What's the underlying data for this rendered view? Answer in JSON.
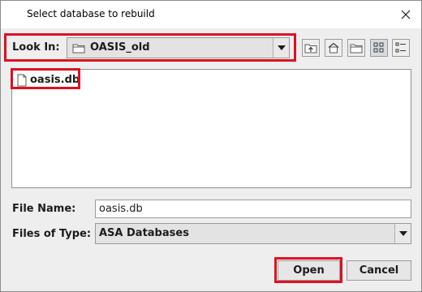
{
  "dialog": {
    "title": "Select database to rebuild",
    "close_glyph": "✕"
  },
  "look_in": {
    "label": "Look In:",
    "value": "OASIS_old",
    "icon": "folder-icon"
  },
  "toolbar": {
    "buttons": [
      {
        "name": "up-one-level-button",
        "icon": "folder-up-icon"
      },
      {
        "name": "home-button",
        "icon": "home-icon"
      },
      {
        "name": "new-folder-button",
        "icon": "new-folder-icon"
      },
      {
        "name": "list-view-button",
        "icon": "list-view-icon",
        "active": true
      },
      {
        "name": "details-view-button",
        "icon": "details-view-icon",
        "active": false
      }
    ]
  },
  "files": [
    {
      "name": "oasis.db",
      "icon": "file-icon"
    }
  ],
  "file_name": {
    "label": "File Name:",
    "value": "oasis.db"
  },
  "files_of_type": {
    "label": "Files of Type:",
    "value": "ASA Databases"
  },
  "buttons": {
    "open": "Open",
    "cancel": "Cancel"
  },
  "colors": {
    "highlight": "#dd1122",
    "dialog_bg": "#eeeeee"
  }
}
